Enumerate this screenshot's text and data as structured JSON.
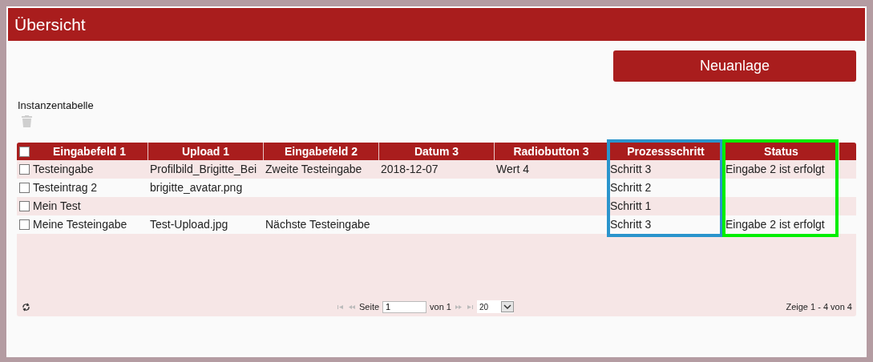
{
  "window": {
    "title": "Übersicht"
  },
  "new_button": "Neuanlage",
  "table_title": "Instanzentabelle",
  "table": {
    "header_checked": false,
    "columns": [
      {
        "label": "Eingabefeld 1"
      },
      {
        "label": "Upload 1"
      },
      {
        "label": "Eingabefeld 2"
      },
      {
        "label": "Datum 3"
      },
      {
        "label": "Radiobutton 3"
      },
      {
        "label": "Prozessschritt",
        "color": "#2a94cc"
      },
      {
        "label": "Status",
        "color": "#00ee00"
      }
    ],
    "rows": [
      {
        "checked": false,
        "cells": [
          "Testeingabe",
          "Profilbild_Brigitte_Bei",
          "Zweite Testeingabe",
          "2018-12-07",
          "Wert 4",
          "Schritt 3",
          "Eingabe 2 ist erfolgt"
        ]
      },
      {
        "checked": false,
        "cells": [
          "Testeintrag 2",
          "brigitte_avatar.png",
          null,
          null,
          null,
          "Schritt 2",
          null
        ]
      },
      {
        "checked": false,
        "cells": [
          "Mein Test",
          null,
          null,
          null,
          null,
          "Schritt 1",
          null
        ]
      },
      {
        "checked": false,
        "cells": [
          "Meine Testeingabe",
          "Test-Upload.jpg",
          "Nächste Testeingabe",
          null,
          null,
          "Schritt 3",
          "Eingabe 2 ist erfolgt"
        ]
      }
    ]
  },
  "pager": {
    "page_label": "Seite",
    "page": "1",
    "of_label": "von 1",
    "page_size": "20",
    "summary": "Zeige 1 - 4 von 4"
  }
}
